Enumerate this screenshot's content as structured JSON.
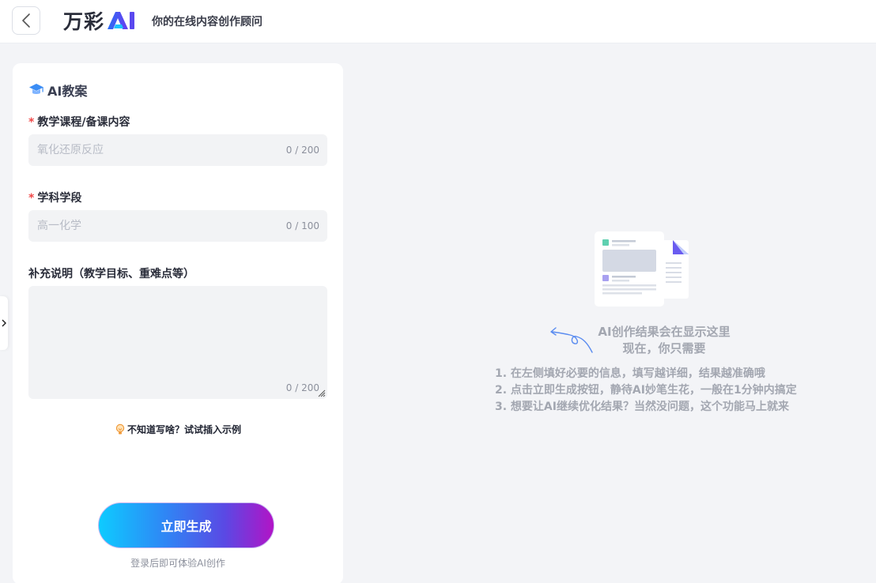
{
  "header": {
    "logo_text": "万彩",
    "tagline": "你的在线内容创作顾问"
  },
  "panel": {
    "title": "AI教案",
    "fields": [
      {
        "label": "教学课程/备课内容",
        "required": "*",
        "placeholder": "氧化还原反应",
        "counter": "0 / 200"
      },
      {
        "label": "学科学段",
        "required": "*",
        "placeholder": "高一化学",
        "counter": "0 / 100"
      },
      {
        "label": "补充说明（教学目标、重难点等）",
        "counter": "0 / 200"
      }
    ],
    "example_hint": "不知道写啥？试试插入示例",
    "generate_label": "立即生成",
    "login_hint": "登录后即可体验AI创作"
  },
  "result": {
    "title_line1": "AI创作结果会在显示这里",
    "title_line2": "现在，你只需要",
    "steps": [
      "1. 在左侧填好必要的信息，填写越详细，结果越准确哦",
      "2. 点击立即生成按钮，静待AI妙笔生花，一般在1分钟内搞定",
      "3. 想要让AI继续优化结果？当然没问题，这个功能马上就来"
    ]
  },
  "colors": {
    "accent_gradient_start": "#0ecbff",
    "accent_gradient_end": "#b214c6",
    "required_mark": "#f04848",
    "page_bg": "#f3f4f7"
  },
  "icons": [
    "back-arrow-icon",
    "ai-logo-icon",
    "graduation-cap-icon",
    "chevron-right-icon",
    "lightbulb-icon",
    "resize-grip-icon",
    "document-illustration",
    "curved-arrow-icon"
  ]
}
